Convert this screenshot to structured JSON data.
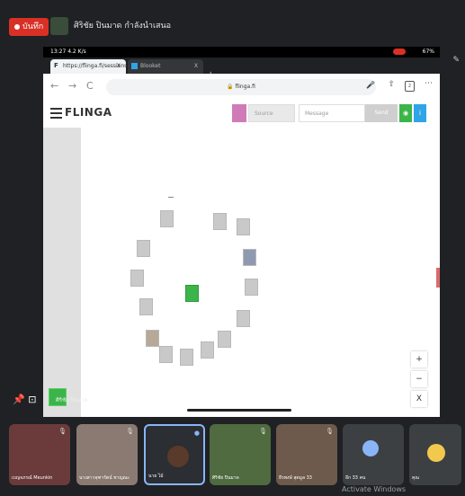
{
  "meet": {
    "record_label": "บันทึก",
    "presenter_text": "ศิริชัย ปินมาด กำลังนำเสนอ"
  },
  "status_bar": {
    "time": "13:27 4.2 K/s",
    "battery": "67%"
  },
  "browser": {
    "tabs": [
      {
        "label": "https://flinga.fi/sessions",
        "close": "X"
      },
      {
        "label": "Blooket",
        "close": "X"
      }
    ],
    "new_tab": "+",
    "back": "←",
    "forward": "→",
    "reload": "C",
    "url": "flinga.fi",
    "tabs_count": "2",
    "more": "⋯"
  },
  "flinga": {
    "brand": "FLINGA",
    "source_placeholder": "Source",
    "message_placeholder": "Message",
    "send_label": "Send",
    "zoom_in": "+",
    "zoom_out": "−",
    "close": "X",
    "colors": {
      "swatch": "#d07bb8",
      "green": "#3bb54a",
      "blue": "#2fa4e7"
    }
  },
  "side_panel": {
    "label": "ศิริชัย ปินมาด"
  },
  "participants": [
    {
      "name": "เบญจภรณ์ Meunkin"
    },
    {
      "name": "นางสาวจุฑารัตน์ ชาญณะ"
    },
    {
      "name": "นาย ไม้"
    },
    {
      "name": "ศิริชัย ปินมาด"
    },
    {
      "name": "ธีรพงษ์ สุดมูล 33"
    },
    {
      "name": "อีก 33 คน"
    },
    {
      "name": "คุณ"
    }
  ],
  "windows_watermark": "Activate Windows"
}
